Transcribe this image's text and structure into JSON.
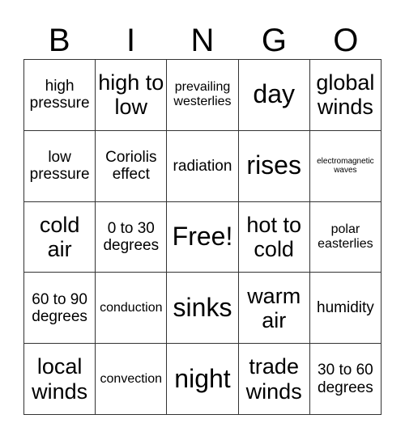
{
  "header": {
    "letters": [
      "B",
      "I",
      "N",
      "G",
      "O"
    ]
  },
  "cells": [
    {
      "text": "high pressure",
      "size": "m"
    },
    {
      "text": "high to low",
      "size": "l"
    },
    {
      "text": "prevailing westerlies",
      "size": "s"
    },
    {
      "text": "day",
      "size": "xl"
    },
    {
      "text": "global winds",
      "size": "l"
    },
    {
      "text": "low pressure",
      "size": "m"
    },
    {
      "text": "Coriolis effect",
      "size": "m"
    },
    {
      "text": "radiation",
      "size": "m"
    },
    {
      "text": "rises",
      "size": "xl"
    },
    {
      "text": "electromagnetic waves",
      "size": "xs"
    },
    {
      "text": "cold air",
      "size": "l"
    },
    {
      "text": "0 to 30 degrees",
      "size": "m"
    },
    {
      "text": "Free!",
      "size": "xl"
    },
    {
      "text": "hot to cold",
      "size": "l"
    },
    {
      "text": "polar easterlies",
      "size": "s"
    },
    {
      "text": "60 to 90 degrees",
      "size": "m"
    },
    {
      "text": "conduction",
      "size": "s"
    },
    {
      "text": "sinks",
      "size": "xl"
    },
    {
      "text": "warm air",
      "size": "l"
    },
    {
      "text": "humidity",
      "size": "m"
    },
    {
      "text": "local winds",
      "size": "l"
    },
    {
      "text": "convection",
      "size": "s"
    },
    {
      "text": "night",
      "size": "xl"
    },
    {
      "text": "trade winds",
      "size": "l"
    },
    {
      "text": "30 to 60 degrees",
      "size": "m"
    }
  ]
}
